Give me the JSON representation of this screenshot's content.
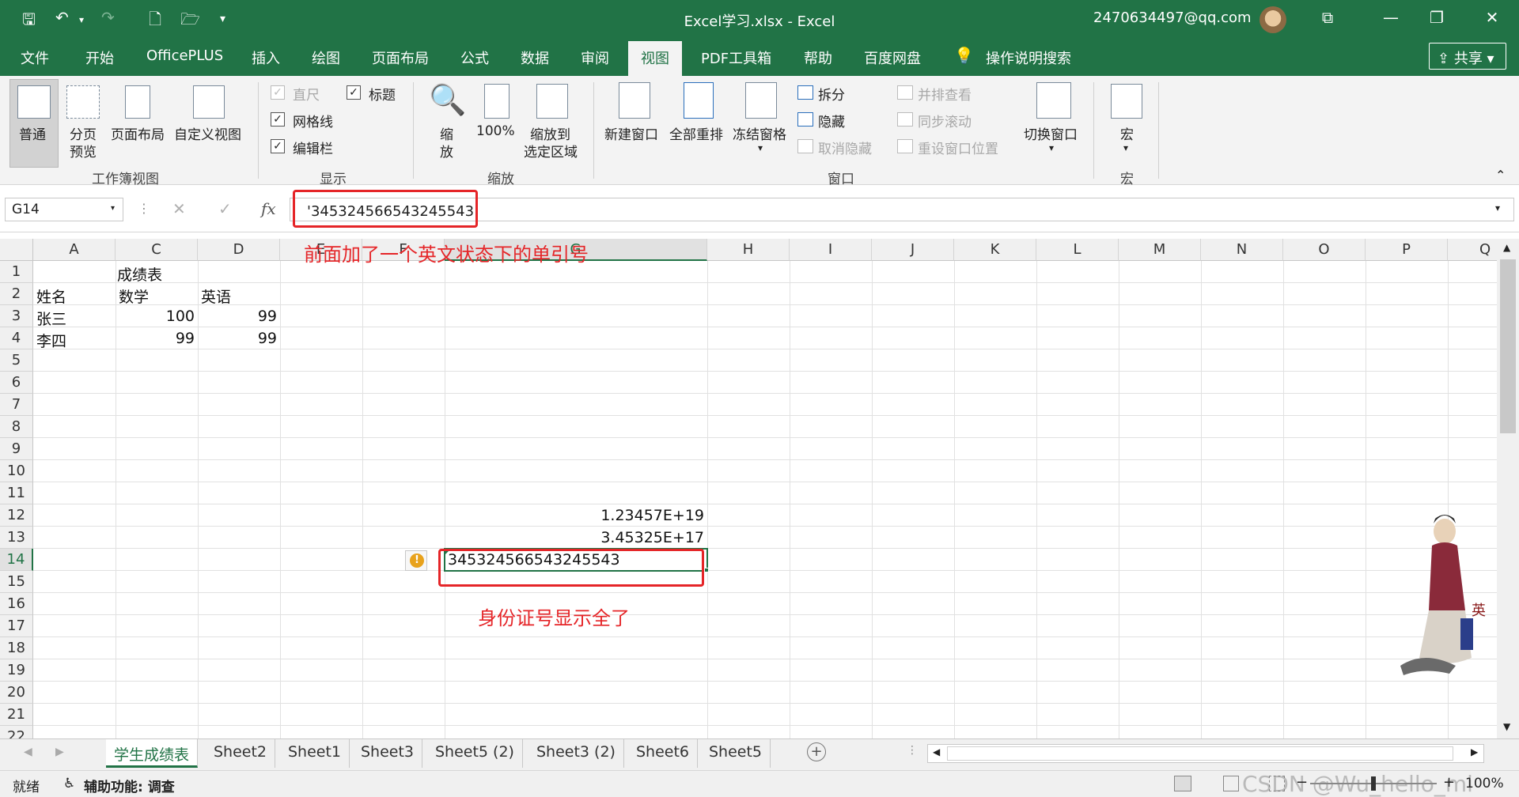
{
  "window": {
    "title": "Excel学习.xlsx  -  Excel",
    "account": "2470634497@qq.com"
  },
  "menu_tabs": [
    "文件",
    "开始",
    "OfficePLUS",
    "插入",
    "绘图",
    "页面布局",
    "公式",
    "数据",
    "审阅",
    "视图",
    "PDF工具箱",
    "帮助",
    "百度网盘"
  ],
  "search_hint": "操作说明搜索",
  "share_label": "共享",
  "ribbon": {
    "workbook_views": {
      "normal": "普通",
      "page_break_1": "分页",
      "page_break_2": "预览",
      "page_layout": "页面布局",
      "custom": "自定义视图",
      "group": "工作簿视图"
    },
    "show": {
      "ruler": "直尺",
      "headings": "标题",
      "gridlines": "网格线",
      "formula_bar": "编辑栏",
      "group": "显示"
    },
    "zoom": {
      "zoom_1": "缩",
      "zoom_2": "放",
      "pct": "100%",
      "fit_1": "缩放到",
      "fit_2": "选定区域",
      "group": "缩放"
    },
    "window": {
      "new": "新建窗口",
      "arrange": "全部重排",
      "freeze": "冻结窗格",
      "split": "拆分",
      "hide": "隐藏",
      "unhide": "取消隐藏",
      "side_by_side": "并排查看",
      "sync_scroll": "同步滚动",
      "reset": "重设窗口位置",
      "switch": "切换窗口",
      "group": "窗口"
    },
    "macros": {
      "label": "宏",
      "group": "宏"
    }
  },
  "formula_bar": {
    "name_box": "G14",
    "content": "'345324566543245543"
  },
  "annotations": {
    "formula_note": "前面加了一个英文状态下的单引号",
    "cell_note": "身份证号显示全了"
  },
  "columns": [
    "A",
    "C",
    "D",
    "E",
    "F",
    "G",
    "H",
    "I",
    "J",
    "K",
    "L",
    "M",
    "N",
    "O",
    "P",
    "Q"
  ],
  "rows": [
    "1",
    "2",
    "3",
    "4",
    "5",
    "6",
    "7",
    "8",
    "9",
    "10",
    "11",
    "12",
    "13",
    "14",
    "15",
    "16",
    "17",
    "18",
    "19",
    "20",
    "21",
    "22"
  ],
  "cells": {
    "c1": "成绩表",
    "a2": "姓名",
    "c2": "数学",
    "d2": "英语",
    "a3": "张三",
    "c3": "100",
    "d3": "99",
    "a4": "李四",
    "c4": "99",
    "d4": "99",
    "g12": "1.23457E+19",
    "g13": "3.45325E+17",
    "g14": "345324566543245543"
  },
  "sheet_tabs": [
    "学生成绩表",
    "Sheet2",
    "Sheet1",
    "Sheet3",
    "Sheet5 (2)",
    "Sheet3 (2)",
    "Sheet6",
    "Sheet5"
  ],
  "status": {
    "ready": "就绪",
    "accessibility": "辅助功能: 调查",
    "watermark": "CSDN @Wu_hello_mi",
    "zoom": "100%"
  },
  "colors": {
    "excel_green": "#217346",
    "annotation_red": "#e52528"
  }
}
